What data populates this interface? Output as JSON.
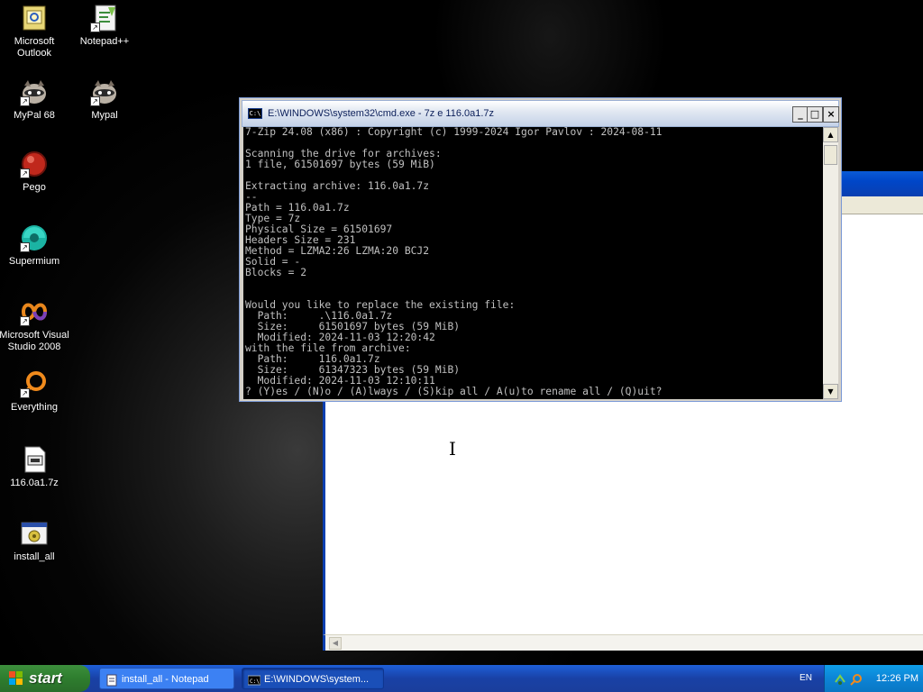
{
  "desktop": {
    "icons": [
      {
        "label": "Microsoft Outlook",
        "icon": "outlook-icon"
      },
      {
        "label": "Notepad++",
        "icon": "notepad-plus-plus-icon"
      },
      {
        "label": "MyPal 68",
        "icon": "mypal-raccoon-icon"
      },
      {
        "label": "Mypal",
        "icon": "mypal-raccoon-icon"
      },
      {
        "label": "Pego",
        "icon": "pego-red-ball-icon"
      },
      {
        "label": "Supermium",
        "icon": "supermium-icon"
      },
      {
        "label": "Microsoft Visual Studio 2008",
        "icon": "visual-studio-icon"
      },
      {
        "label": "Everything",
        "icon": "everything-search-icon"
      },
      {
        "label": "116.0a1.7z",
        "icon": "archive-file-icon"
      },
      {
        "label": "install_all",
        "icon": "batch-file-icon"
      }
    ]
  },
  "cmd_window": {
    "title": "E:\\WINDOWS\\system32\\cmd.exe - 7z e 116.0a1.7z",
    "icon_text": "C:\\",
    "buttons": {
      "minimize": "_",
      "maximize": "□",
      "close": "×"
    },
    "console_lines": [
      "7-Zip 24.08 (x86) : Copyright (c) 1999-2024 Igor Pavlov : 2024-08-11",
      "",
      "Scanning the drive for archives:",
      "1 file, 61501697 bytes (59 MiB)",
      "",
      "Extracting archive: 116.0a1.7z",
      "--",
      "Path = 116.0a1.7z",
      "Type = 7z",
      "Physical Size = 61501697",
      "Headers Size = 231",
      "Method = LZMA2:26 LZMA:20 BCJ2",
      "Solid = -",
      "Blocks = 2",
      "",
      "",
      "Would you like to replace the existing file:",
      "  Path:     .\\116.0a1.7z",
      "  Size:     61501697 bytes (59 MiB)",
      "  Modified: 2024-11-03 12:20:42",
      "with the file from archive:",
      "  Path:     116.0a1.7z",
      "  Size:     61347323 bytes (59 MiB)",
      "  Modified: 2024-11-03 12:10:11",
      "? (Y)es / (N)o / (A)lways / (S)kip all / A(u)to rename all / (Q)uit?"
    ]
  },
  "taskbar": {
    "start_label": "start",
    "tasks": [
      {
        "label": "install_all - Notepad",
        "icon": "notepad-icon"
      },
      {
        "label": "E:\\WINDOWS\\system...",
        "icon": "cmd-icon"
      }
    ],
    "language": "EN",
    "clock": "12:26 PM"
  },
  "colors": {
    "taskbar": "#1941a5",
    "start": "#2e7d2e",
    "console_bg": "#000000",
    "console_text": "#c0c0c0"
  }
}
